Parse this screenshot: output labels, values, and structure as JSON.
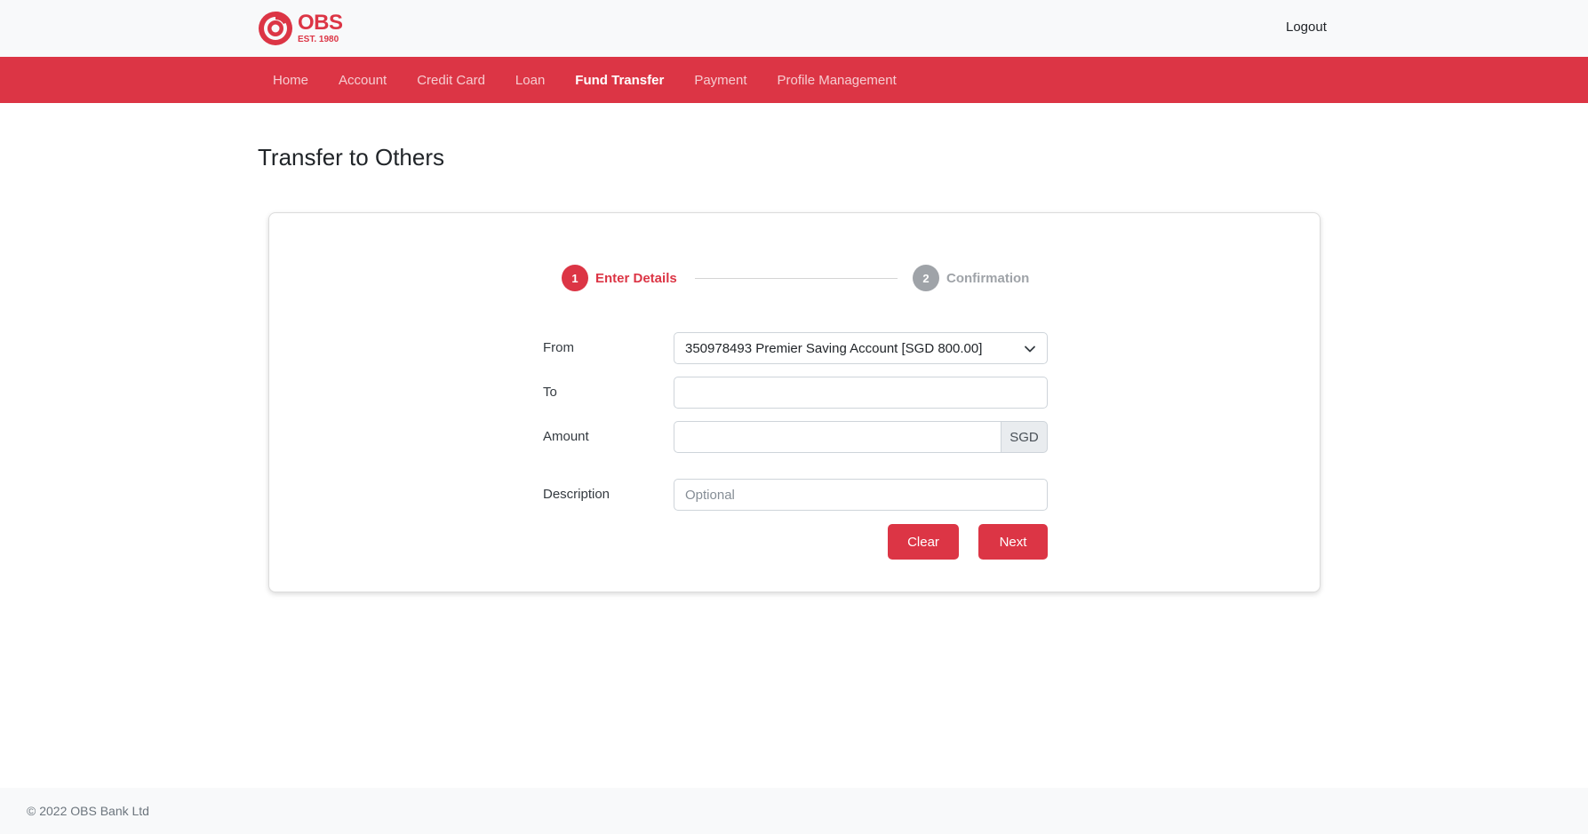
{
  "brand": {
    "name": "OBS",
    "established": "EST. 1980",
    "color": "#dc3545"
  },
  "header": {
    "logout_label": "Logout"
  },
  "nav": {
    "items": [
      {
        "label": "Home",
        "active": false
      },
      {
        "label": "Account",
        "active": false
      },
      {
        "label": "Credit Card",
        "active": false
      },
      {
        "label": "Loan",
        "active": false
      },
      {
        "label": "Fund Transfer",
        "active": true
      },
      {
        "label": "Payment",
        "active": false
      },
      {
        "label": "Profile Management",
        "active": false
      }
    ]
  },
  "page": {
    "title": "Transfer to Others"
  },
  "stepper": {
    "steps": [
      {
        "number": "1",
        "label": "Enter Details",
        "status": "active"
      },
      {
        "number": "2",
        "label": "Confirmation",
        "status": "inactive"
      }
    ]
  },
  "form": {
    "from": {
      "label": "From",
      "selected": "350978493 Premier Saving Account [SGD 800.00]",
      "icon": "chevron-down-icon"
    },
    "to": {
      "label": "To",
      "value": "",
      "placeholder": ""
    },
    "amount": {
      "label": "Amount",
      "value": "",
      "currency": "SGD"
    },
    "description": {
      "label": "Description",
      "value": "",
      "placeholder": "Optional"
    },
    "buttons": {
      "clear_label": "Clear",
      "next_label": "Next"
    }
  },
  "footer": {
    "text": "© 2022 OBS Bank Ltd"
  }
}
